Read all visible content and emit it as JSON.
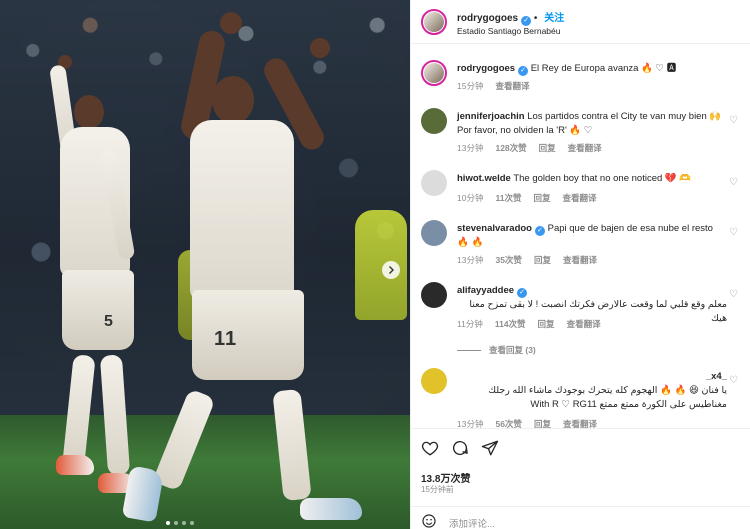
{
  "post": {
    "author": "rodrygogoes",
    "follow_label": "关注",
    "location": "Estadio Santiago Bernabéu",
    "caption_text": "El Rey de Europa avanza 🔥 ♡ 🅰",
    "caption_time": "15分钟",
    "caption_translate": "查看翻译",
    "jersey_numbers": [
      "5",
      "11"
    ],
    "likes": "13.8万次赞",
    "post_time": "15分钟前",
    "add_comment_placeholder": "添加评论..."
  },
  "comments": [
    {
      "user": "jenniferjoachin",
      "text": "Los partidos contra el City te van muy bien 🙌 Por favor, no olviden la 'R' 🔥 ♡",
      "time": "13分钟",
      "likes": "128次赞",
      "reply": "回复",
      "translate": "查看翻译",
      "avatar_color": "#5a6b3a"
    },
    {
      "user": "hiwot.welde",
      "text": "The golden boy that no one noticed 💔 🫶",
      "time": "10分钟",
      "likes": "11次赞",
      "reply": "回复",
      "translate": "查看翻译",
      "avatar_color": "#dcdcdc"
    },
    {
      "user": "stevenalvaradoo",
      "text": "Papi que de bajen de esa nube el resto 🔥 🔥",
      "time": "13分钟",
      "likes": "35次赞",
      "reply": "回复",
      "translate": "查看翻译",
      "avatar_color": "#7a8ea6"
    },
    {
      "user": "alifayyaddee",
      "text": "معلم وقع قلبي لما وقعت عالارض فكرتك انصبت ! لا بقى تمزح معنا هيك",
      "time": "11分钟",
      "likes": "114次赞",
      "reply": "回复",
      "translate": "查看翻译",
      "avatar_color": "#2a2a2a"
    },
    {
      "user": "_x4_",
      "text": "يا فنان 😆 🔥 🔥 الهجوم كله يتحرك بوجودك ماشاء الله رجلك مغناطيس على الكورة ممتع ممتع With R ♡ RG11",
      "time": "13分钟",
      "likes": "56次赞",
      "reply": "回复",
      "translate": "查看翻译",
      "avatar_color": "#e1c22a"
    }
  ],
  "view_replies": "查看回复 (3)",
  "icons": {
    "like": "heart-icon",
    "comment": "comment-icon",
    "share": "send-icon",
    "next": "chevron-right-icon",
    "emoji": "emoji-icon"
  },
  "colors": {
    "accent": "#0095f6",
    "verified": "#3897f0",
    "muted": "#8e8e8e"
  }
}
